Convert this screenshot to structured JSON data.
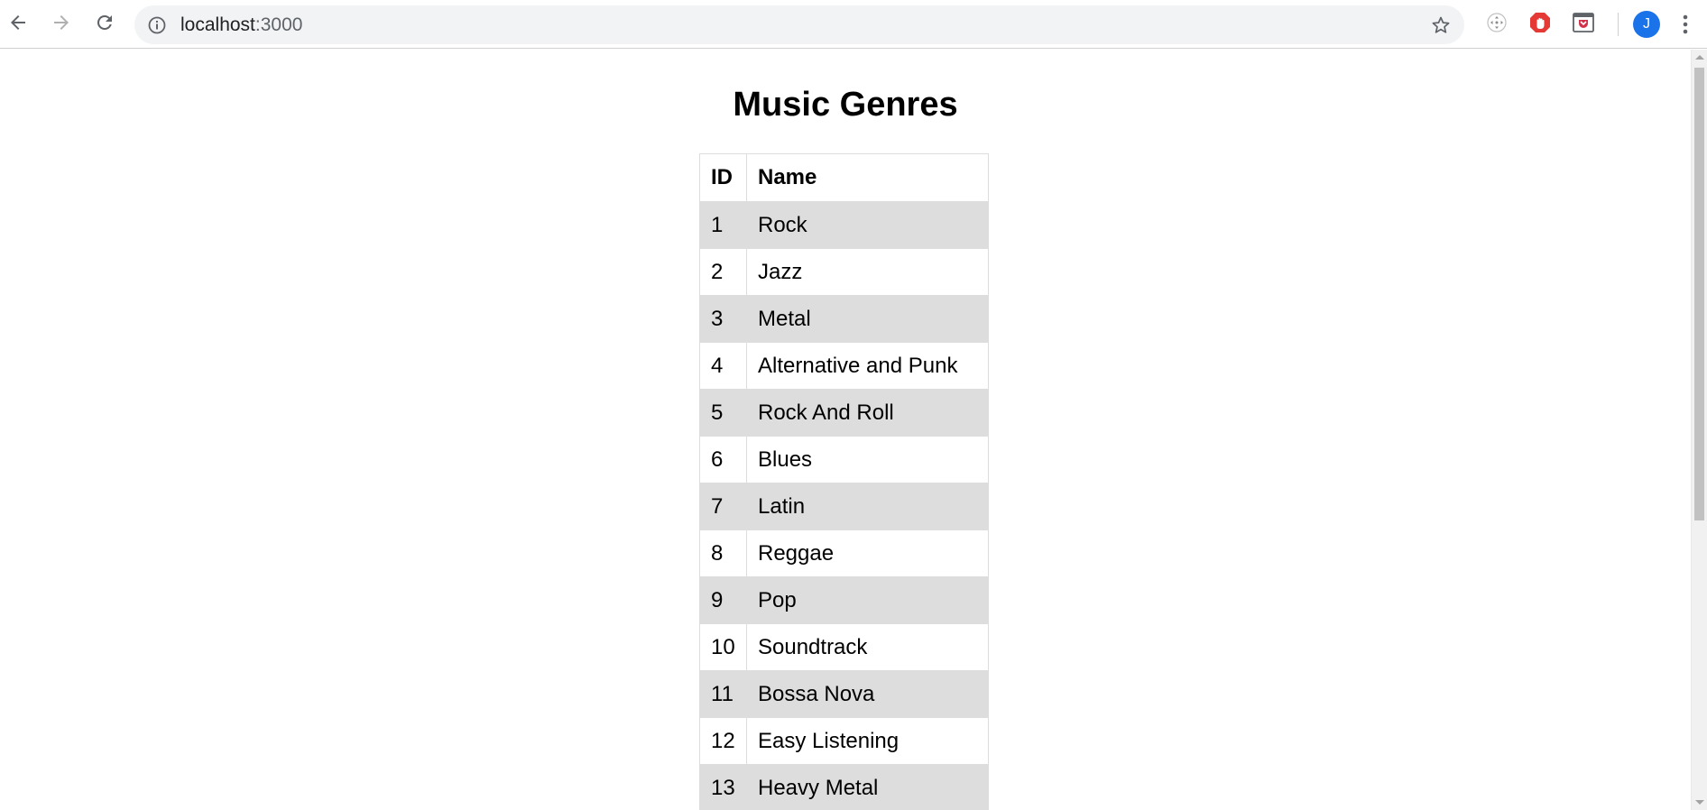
{
  "browser": {
    "url_host": "localhost",
    "url_port": ":3000",
    "avatar_letter": "J",
    "icons": {
      "back": "back-arrow-icon",
      "forward": "forward-arrow-icon",
      "reload": "reload-icon",
      "info": "info-icon",
      "bookmark": "star-icon",
      "menu": "kebab-menu-icon"
    }
  },
  "page": {
    "title": "Music Genres",
    "table": {
      "headers": {
        "id": "ID",
        "name": "Name"
      },
      "rows": [
        {
          "id": "1",
          "name": "Rock"
        },
        {
          "id": "2",
          "name": "Jazz"
        },
        {
          "id": "3",
          "name": "Metal"
        },
        {
          "id": "4",
          "name": "Alternative and Punk"
        },
        {
          "id": "5",
          "name": "Rock And Roll"
        },
        {
          "id": "6",
          "name": "Blues"
        },
        {
          "id": "7",
          "name": "Latin"
        },
        {
          "id": "8",
          "name": "Reggae"
        },
        {
          "id": "9",
          "name": "Pop"
        },
        {
          "id": "10",
          "name": "Soundtrack"
        },
        {
          "id": "11",
          "name": "Bossa Nova"
        },
        {
          "id": "12",
          "name": "Easy Listening"
        },
        {
          "id": "13",
          "name": "Heavy Metal"
        }
      ],
      "stripe_color": "#dddddd"
    }
  },
  "colors": {
    "avatar": "#1a73e8",
    "omnibox_bg": "#f1f3f4",
    "extension_red": "#e53935",
    "extension_pocket": "#d3304a"
  }
}
